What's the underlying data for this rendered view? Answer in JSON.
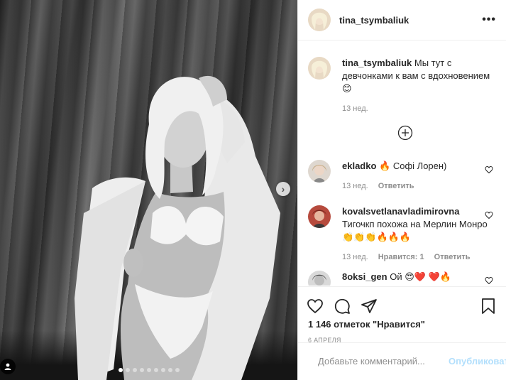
{
  "post": {
    "username": "tina_tsymbaliuk",
    "more_icon": "ellipsis-icon"
  },
  "caption": {
    "username": "tina_tsymbaliuk",
    "text": "Мы тут с девчонками к вам с вдохновением 😊",
    "time": "13 нед."
  },
  "comments": [
    {
      "username": "ekladko",
      "text": "🔥 Софі Лорен)",
      "time": "13 нед.",
      "likes": "",
      "reply": "Ответить"
    },
    {
      "username": "kovalsvetlanavladimirovna",
      "text": "Тигочкп похожа на Мерлин Монро 👏👏👏🔥🔥🔥",
      "time": "13 нед.",
      "likes": "Нравится: 1",
      "reply": "Ответить"
    },
    {
      "username": "8oksi_gen",
      "text": "Ой 😍❤️ ❤️🔥",
      "time": "",
      "likes": "",
      "reply": ""
    }
  ],
  "actions": {
    "likes": "1 146 отметок \"Нравится\"",
    "date": "6 АПРЕЛЯ"
  },
  "add_comment": {
    "placeholder": "Добавьте комментарий...",
    "post_label": "Опубликовать"
  },
  "media": {
    "slide_count": 9,
    "active_slide": 1
  }
}
